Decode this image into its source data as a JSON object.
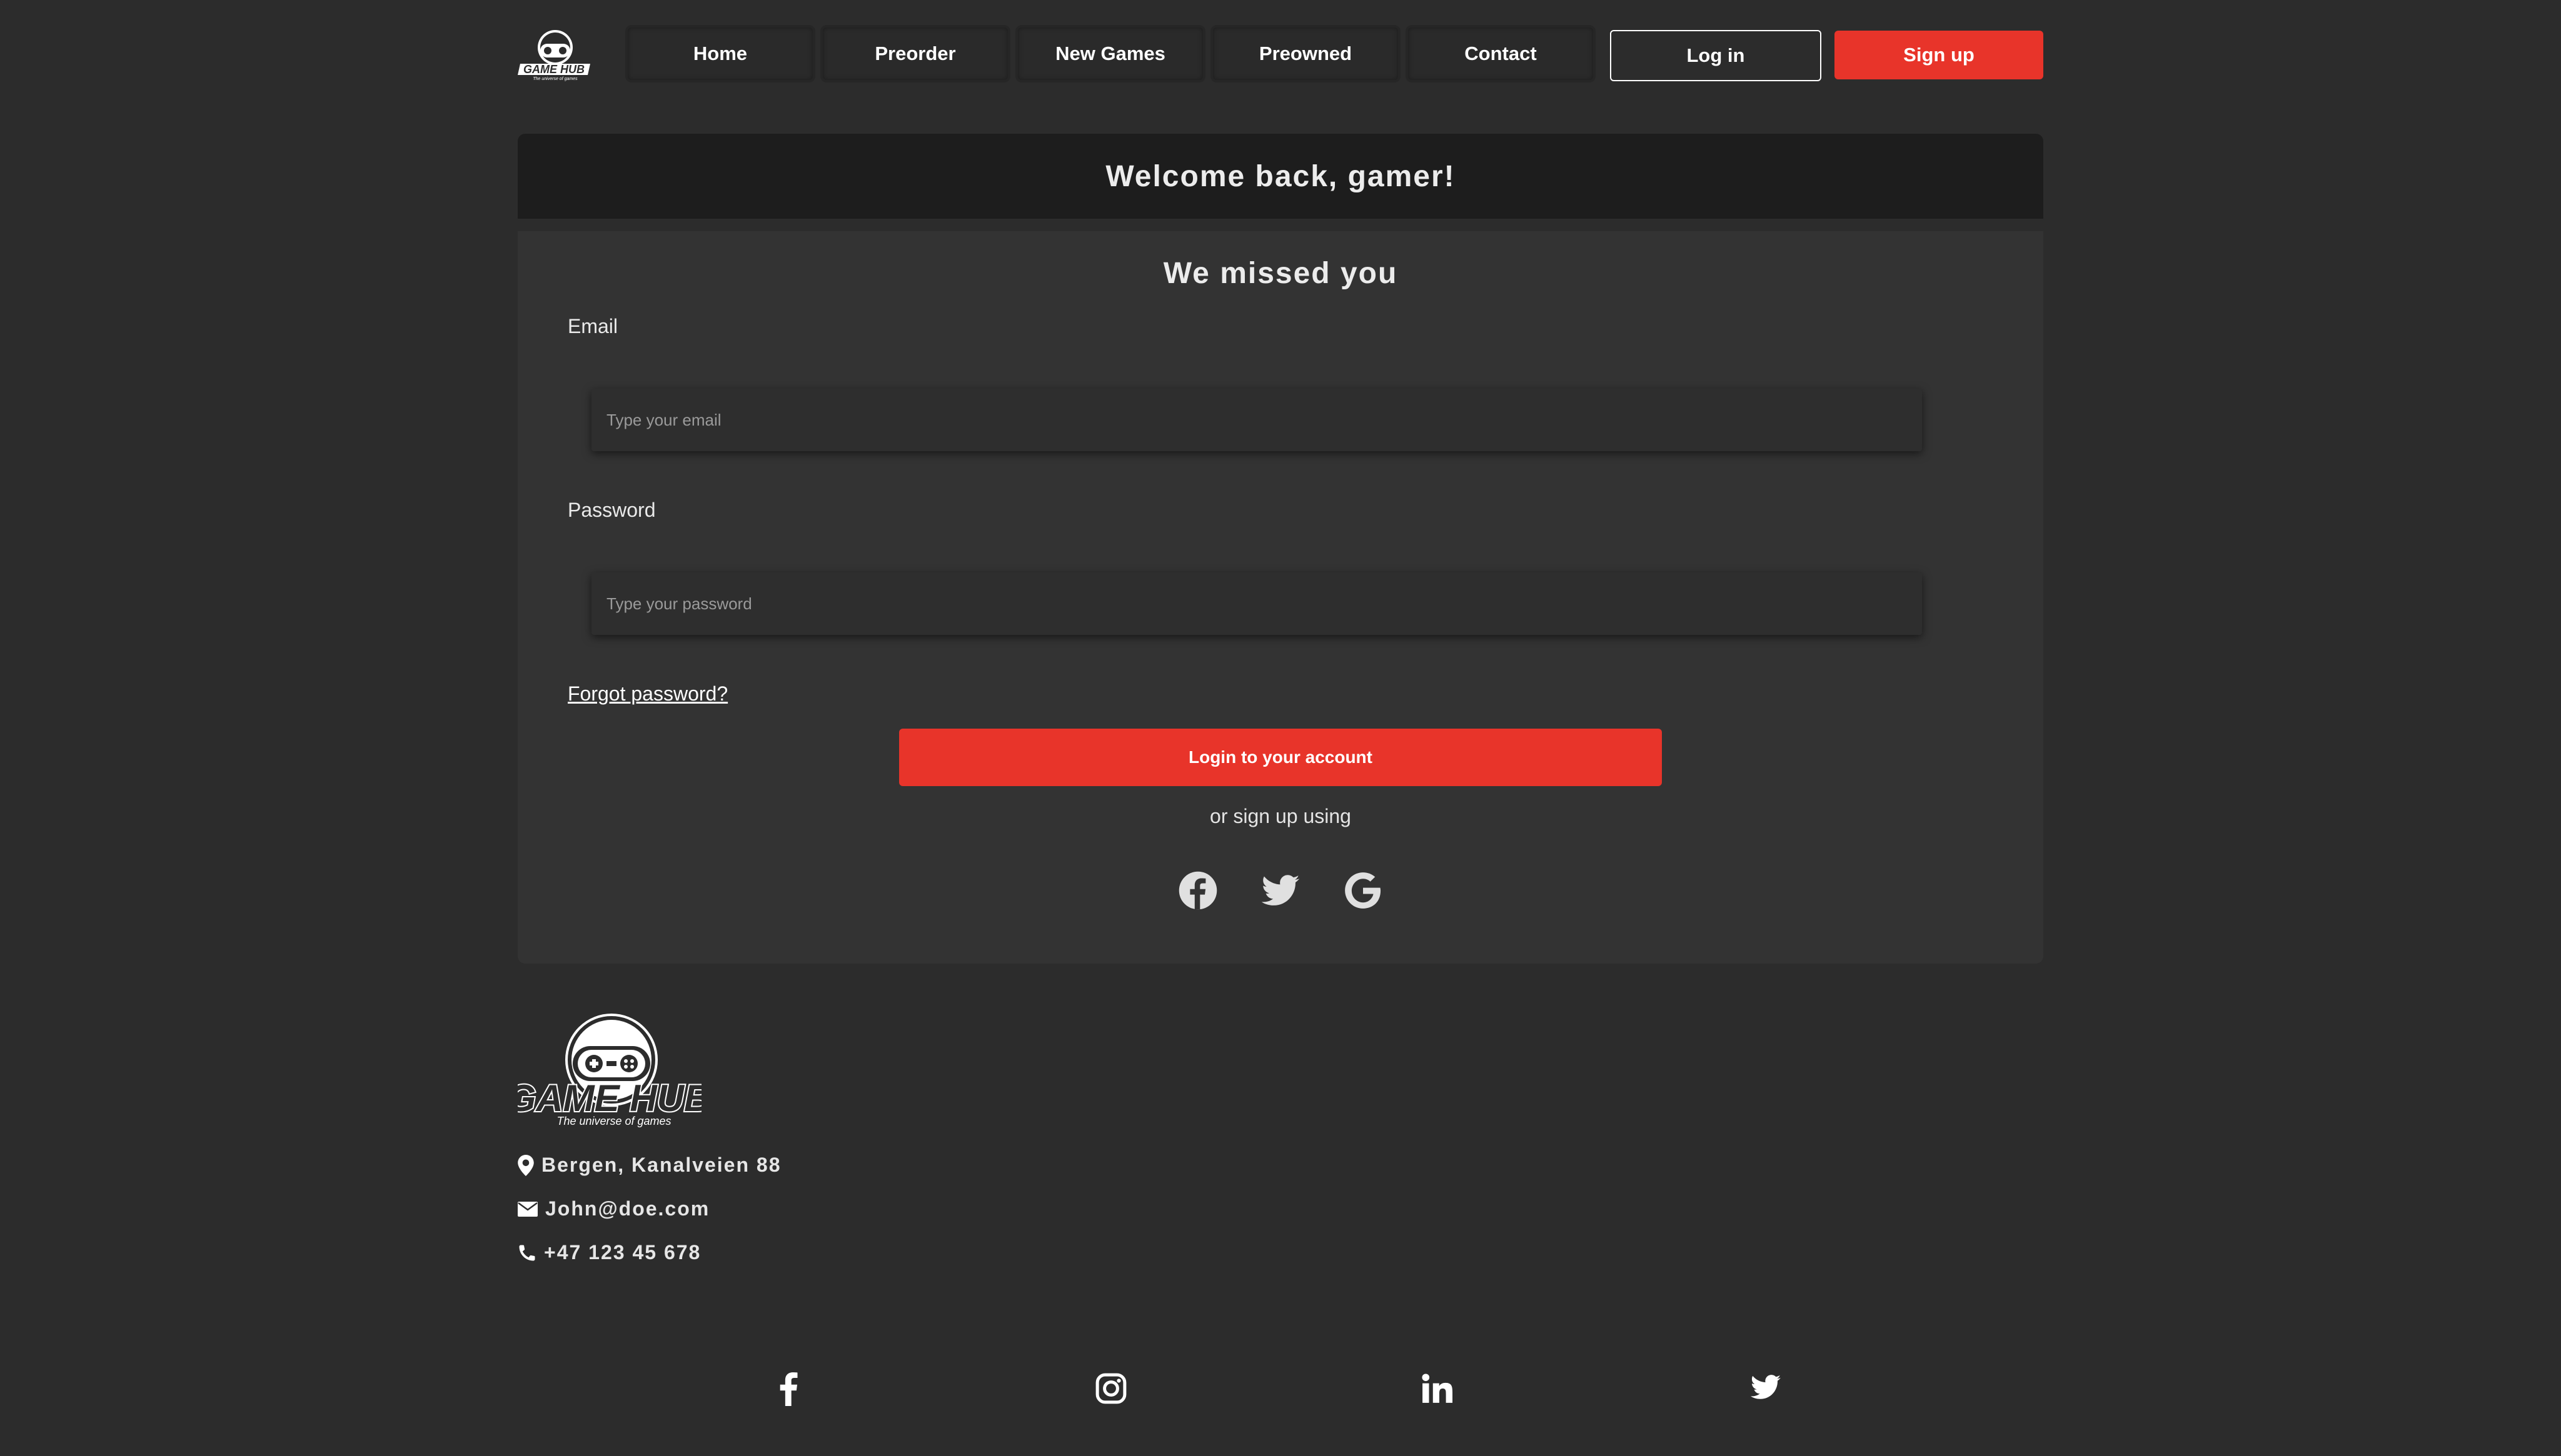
{
  "brand": {
    "name": "GAME HUB",
    "tagline": "The universe of games"
  },
  "nav": {
    "items": [
      "Home",
      "Preorder",
      "New Games",
      "Preowned",
      "Contact"
    ],
    "login_label": "Log in",
    "signup_label": "Sign up"
  },
  "card": {
    "title": "Welcome back, gamer!",
    "subtitle": "We missed you",
    "email_label": "Email",
    "email_placeholder": "Type your email",
    "password_label": "Password",
    "password_placeholder": "Type your password",
    "forgot_label": "Forgot password?",
    "submit_label": "Login to your account",
    "alt_label": "or sign up using",
    "social_icons": [
      "facebook-icon",
      "twitter-icon",
      "google-icon"
    ]
  },
  "footer": {
    "address": "Bergen, Kanalveien 88",
    "email": "John@doe.com",
    "phone": "+47 123 45 678",
    "social_icons": [
      "facebook-icon",
      "instagram-icon",
      "linkedin-icon",
      "twitter-icon"
    ]
  },
  "colors": {
    "background": "#2c2c2c",
    "card_header": "#1d1d1d",
    "card_body": "#333333",
    "accent": "#e8342a",
    "text": "#ffffff"
  }
}
